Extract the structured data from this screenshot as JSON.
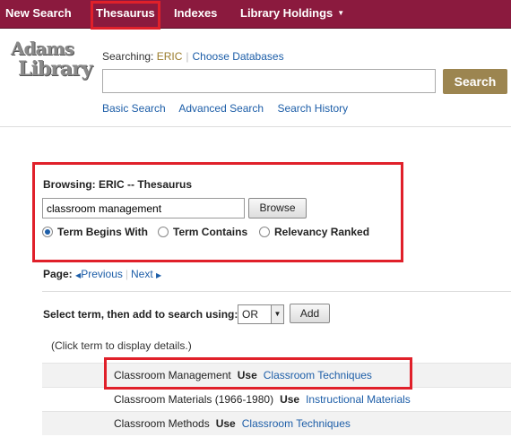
{
  "nav": {
    "items": [
      {
        "label": "New Search"
      },
      {
        "label": "Thesaurus"
      },
      {
        "label": "Indexes"
      },
      {
        "label": "Library Holdings"
      }
    ],
    "caret": "▼"
  },
  "logo": {
    "line1": "Adams",
    "line2": "Library"
  },
  "header": {
    "searching_label": "Searching:",
    "database": "ERIC",
    "choose_databases": "Choose Databases",
    "search_value": "",
    "search_button": "Search",
    "links": [
      "Basic Search",
      "Advanced Search",
      "Search History"
    ]
  },
  "browse": {
    "label": "Browsing: ERIC -- Thesaurus",
    "input_value": "classroom management",
    "button": "Browse",
    "options": [
      {
        "label": "Term Begins With",
        "selected": true
      },
      {
        "label": "Term Contains",
        "selected": false
      },
      {
        "label": "Relevancy Ranked",
        "selected": false
      }
    ]
  },
  "pager": {
    "page_label": "Page:",
    "previous": "Previous",
    "next": "Next"
  },
  "add_to_search": {
    "label": "Select term, then add to search using:",
    "operator": "OR",
    "button": "Add"
  },
  "note": "(Click term to display details.)",
  "terms": [
    {
      "term": "Classroom Management",
      "use_label": "Use",
      "use_term": "Classroom Techniques"
    },
    {
      "term": "Classroom Materials (1966-1980)",
      "use_label": "Use",
      "use_term": "Instructional Materials"
    },
    {
      "term": "Classroom Methods",
      "use_label": "Use",
      "use_term": "Classroom Techniques"
    }
  ],
  "colors": {
    "nav_bg": "#8b1a3e",
    "link": "#1d5ea8",
    "search_button": "#9c8550",
    "highlight": "#e0202a"
  }
}
